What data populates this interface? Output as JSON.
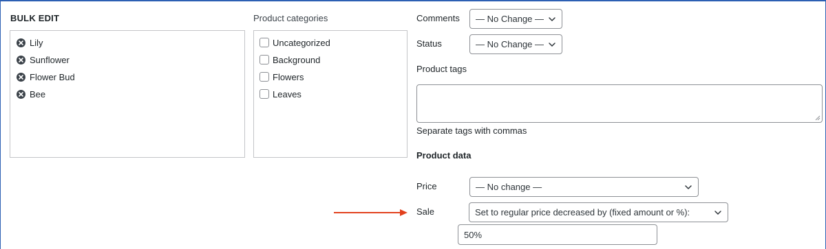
{
  "bulk_edit": {
    "heading": "BULK EDIT",
    "titles": [
      {
        "label": "Lily",
        "icon": "remove-circle-icon"
      },
      {
        "label": "Sunflower",
        "icon": "remove-circle-icon"
      },
      {
        "label": "Flower Bud",
        "icon": "remove-circle-icon"
      },
      {
        "label": "Bee",
        "icon": "remove-circle-icon"
      }
    ]
  },
  "categories": {
    "heading": "Product categories",
    "items": [
      {
        "label": "Uncategorized",
        "checked": false
      },
      {
        "label": "Background",
        "checked": false
      },
      {
        "label": "Flowers",
        "checked": false
      },
      {
        "label": "Leaves",
        "checked": false
      }
    ]
  },
  "fields": {
    "comments": {
      "label": "Comments",
      "value": "— No Change —"
    },
    "status": {
      "label": "Status",
      "value": "— No Change —"
    },
    "tags": {
      "label": "Product tags",
      "value": "",
      "hint": "Separate tags with commas"
    }
  },
  "product_data": {
    "heading": "Product data",
    "price": {
      "label": "Price",
      "value": "— No change —"
    },
    "sale": {
      "label": "Sale",
      "value": "Set to regular price decreased by (fixed amount or %):"
    },
    "sale_amount": {
      "value": "50%"
    }
  },
  "colors": {
    "frame_border": "#2c5fb3",
    "annotation_arrow": "#e2401c",
    "box_border": "#c3c4c7",
    "input_border": "#8c8f94"
  }
}
